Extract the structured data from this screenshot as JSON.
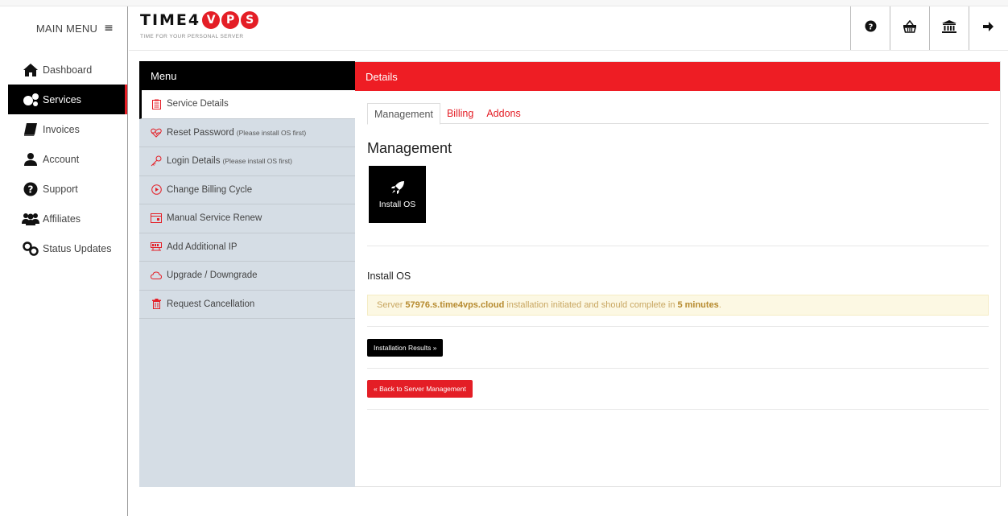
{
  "sidebar": {
    "toggle_label": "MAIN MENU",
    "toggle_icon": "≡",
    "items": [
      {
        "label": "Dashboard",
        "icon": "home-icon"
      },
      {
        "label": "Services",
        "icon": "gears-icon",
        "active": true
      },
      {
        "label": "Invoices",
        "icon": "book-icon"
      },
      {
        "label": "Account",
        "icon": "user-icon"
      },
      {
        "label": "Support",
        "icon": "question-circle-icon"
      },
      {
        "label": "Affiliates",
        "icon": "users-icon"
      },
      {
        "label": "Status Updates",
        "icon": "link-icon"
      }
    ]
  },
  "header": {
    "logo_text": "TIME4",
    "logo_letters": [
      "V",
      "P",
      "S"
    ],
    "tagline": "TIME FOR YOUR PERSONAL SERVER",
    "icons": [
      "help-icon",
      "basket-icon",
      "bank-icon",
      "logout-icon"
    ]
  },
  "menu": {
    "title": "Menu",
    "items": [
      {
        "label": "Service Details",
        "note": "",
        "icon": "clipboard-icon"
      },
      {
        "label": "Reset Password",
        "note": "(Please install OS first)",
        "icon": "heartbeat-icon"
      },
      {
        "label": "Login Details",
        "note": "(Please install OS first)",
        "icon": "key-icon"
      },
      {
        "label": "Change Billing Cycle",
        "note": "",
        "icon": "play-circle-icon"
      },
      {
        "label": "Manual Service Renew",
        "note": "",
        "icon": "calendar-icon"
      },
      {
        "label": "Add Additional IP",
        "note": "",
        "icon": "network-icon"
      },
      {
        "label": "Upgrade / Downgrade",
        "note": "",
        "icon": "cloud-icon"
      },
      {
        "label": "Request Cancellation",
        "note": "",
        "icon": "trash-icon"
      }
    ]
  },
  "details": {
    "title": "Details",
    "tabs": [
      {
        "label": "Management",
        "active": true
      },
      {
        "label": "Billing"
      },
      {
        "label": "Addons"
      }
    ],
    "management_title": "Management",
    "tile_label": "Install OS",
    "install_title": "Install OS",
    "alert": {
      "prefix": "Server",
      "server": "57976.s.time4vps.cloud",
      "middle": "installation initiated and should complete in",
      "duration": "5 minutes",
      "suffix": "."
    },
    "results_button": "Installation Results »",
    "back_button": "« Back to Server Management"
  },
  "colors": {
    "brand_red": "#e41e26",
    "header_red": "#ee1d24",
    "menu_bg": "#d5dde5",
    "alert_bg": "#fcf8e3"
  }
}
